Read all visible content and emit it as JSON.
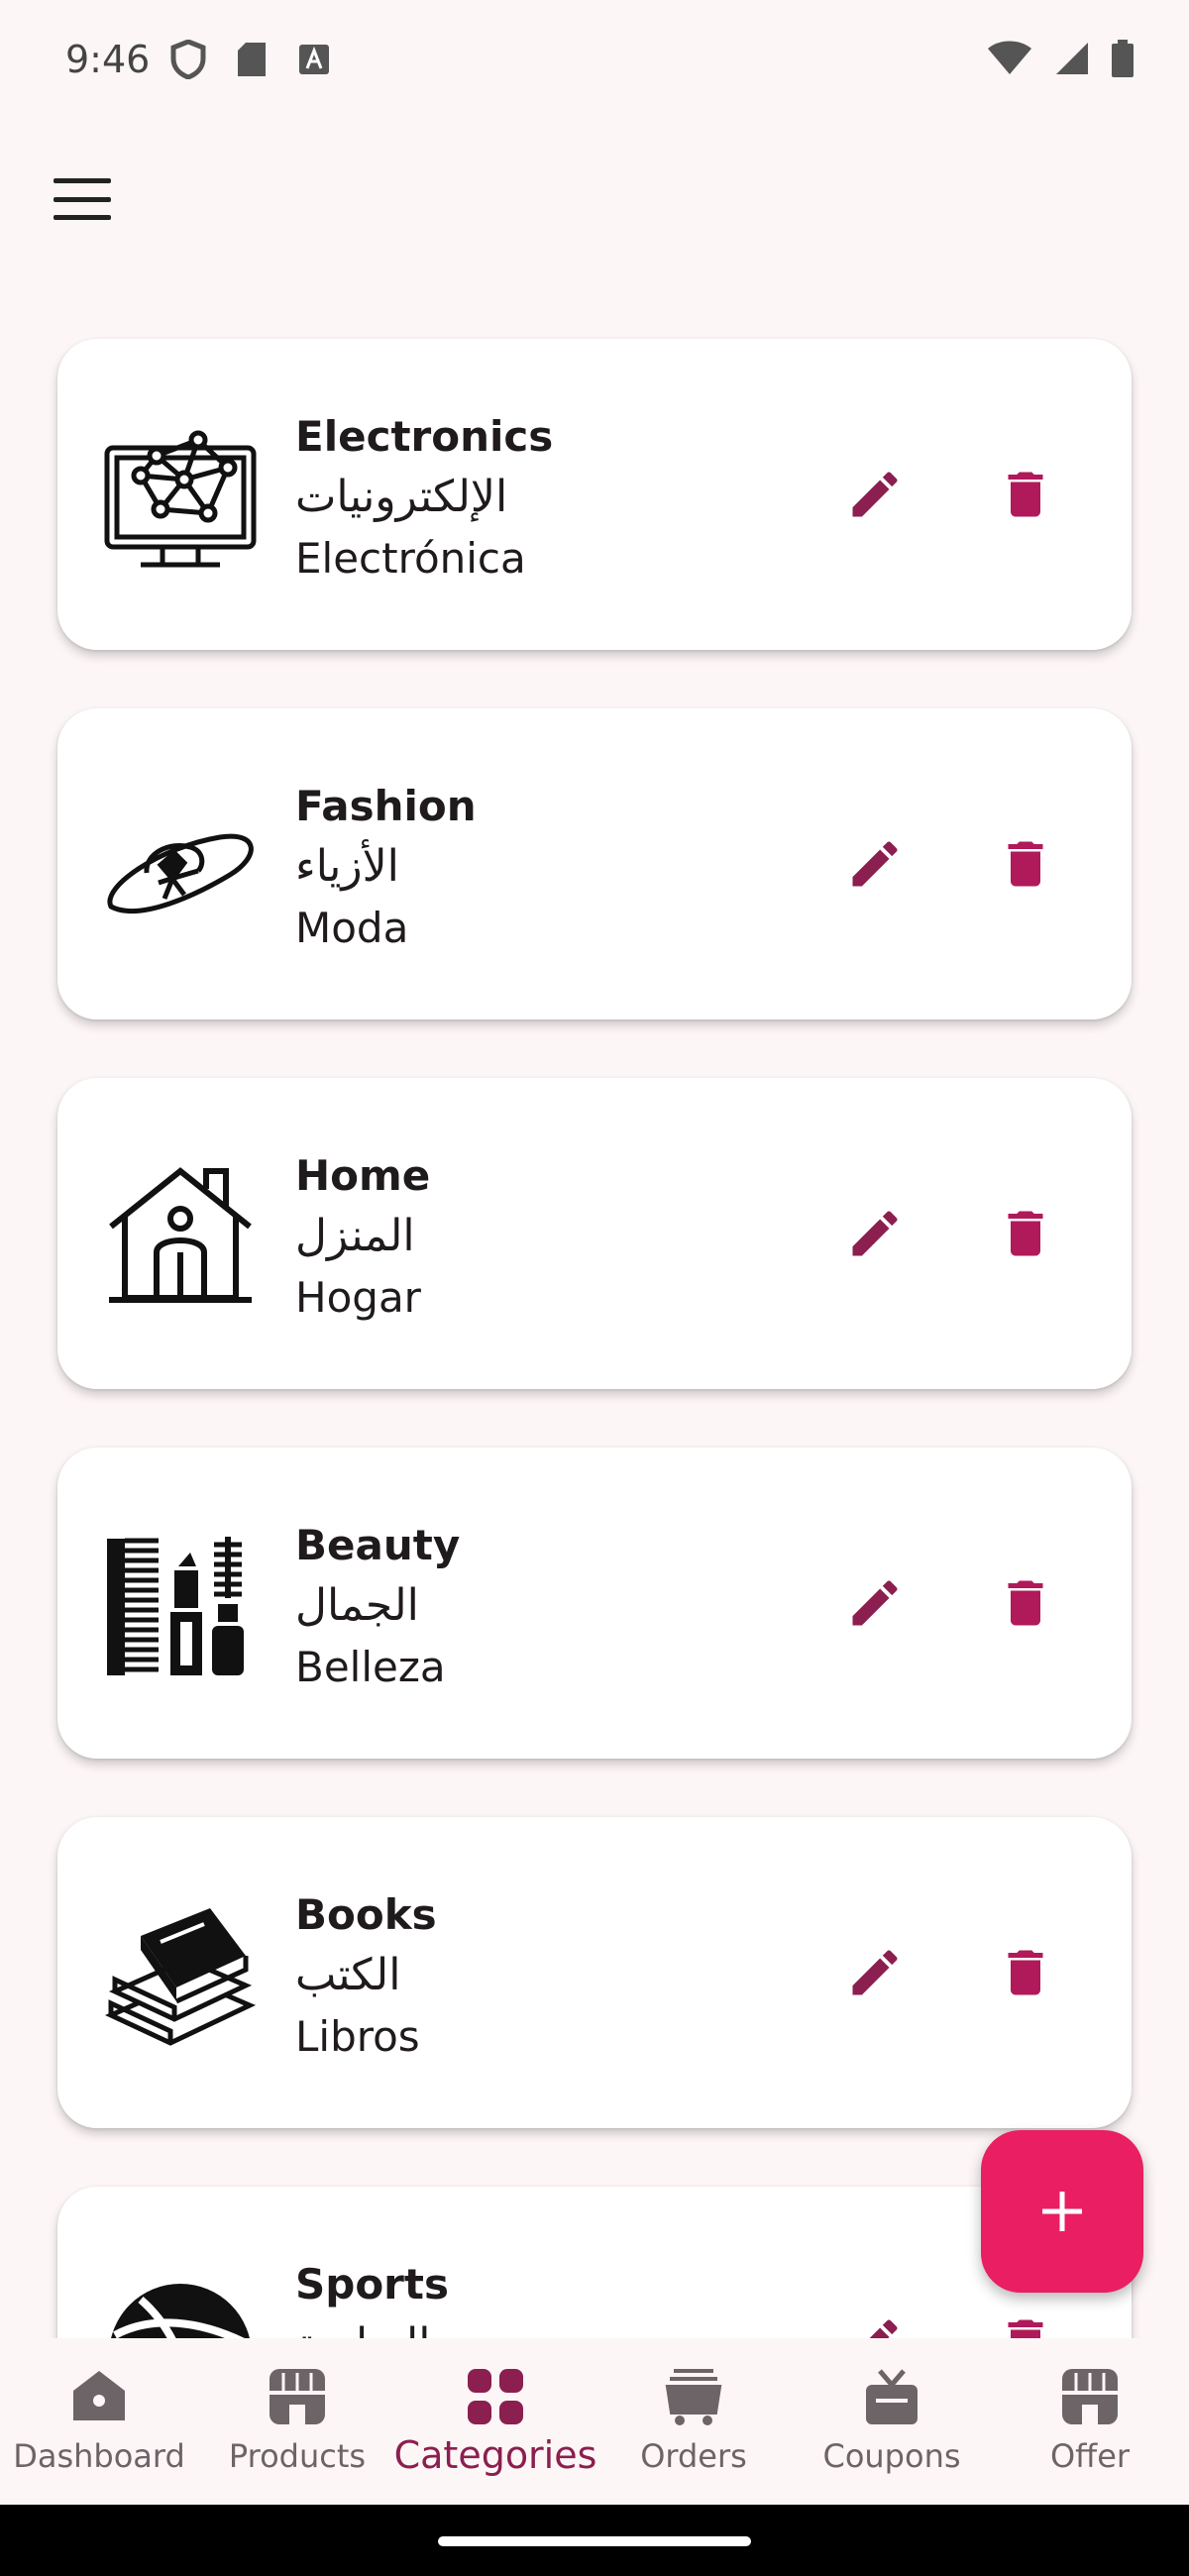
{
  "status_bar": {
    "time": "9:46",
    "icons": [
      "shield-icon",
      "sd-card-icon",
      "keyboard-a-icon",
      "wifi-icon",
      "signal-icon",
      "battery-icon"
    ]
  },
  "header": {
    "menu_icon": "hamburger-menu-icon"
  },
  "colors": {
    "background": "#fdf6f6",
    "card": "#ffffff",
    "accent": "#8b1f4f",
    "fab": "#e91e63",
    "icon_inactive": "#6d6468"
  },
  "categories": [
    {
      "name_en": "Electronics",
      "name_ar": "الإلكترونيات",
      "name_es": "Electrónica",
      "icon": "computer-network-icon"
    },
    {
      "name_en": "Fashion",
      "name_ar": "الأزياء",
      "name_es": "Moda",
      "icon": "hat-icon"
    },
    {
      "name_en": "Home",
      "name_ar": "المنزل",
      "name_es": "Hogar",
      "icon": "house-icon"
    },
    {
      "name_en": "Beauty",
      "name_ar": "الجمال",
      "name_es": "Belleza",
      "icon": "beauty-tools-icon"
    },
    {
      "name_en": "Books",
      "name_ar": "الكتب",
      "name_es": "Libros",
      "icon": "books-icon"
    },
    {
      "name_en": "Sports",
      "name_ar": "الرياضة",
      "name_es": "",
      "icon": "ball-icon"
    }
  ],
  "actions": {
    "edit_icon": "pencil-icon",
    "delete_icon": "trash-icon",
    "fab_icon": "plus-icon"
  },
  "bottom_nav": {
    "items": [
      {
        "label": "Dashboard",
        "icon": "dashboard-icon",
        "active": false
      },
      {
        "label": "Products",
        "icon": "store-icon",
        "active": false
      },
      {
        "label": "Categories",
        "icon": "grid-icon",
        "active": true
      },
      {
        "label": "Orders",
        "icon": "cart-icon",
        "active": false
      },
      {
        "label": "Coupons",
        "icon": "gift-icon",
        "active": false
      },
      {
        "label": "Offer",
        "icon": "store-icon",
        "active": false
      }
    ]
  }
}
